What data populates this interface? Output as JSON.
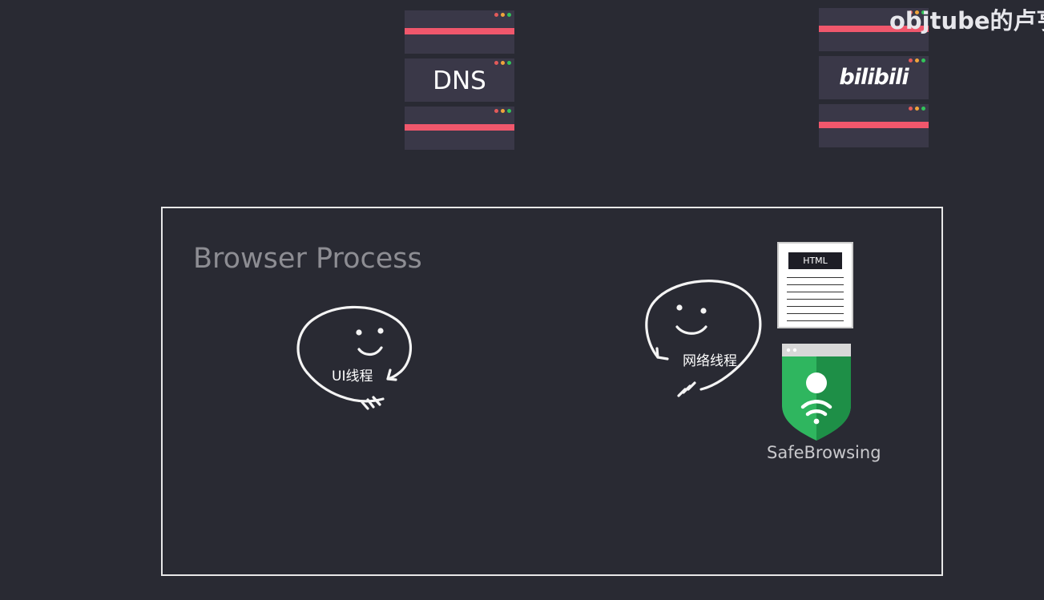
{
  "watermark": "objtube的卢亨",
  "servers": {
    "dns_label": "DNS",
    "bilibili_label": "bilibili"
  },
  "diagram": {
    "title": "Browser Process",
    "ui_thread_label": "UI线程",
    "network_thread_label": "网络线程",
    "html_tag": "HTML",
    "safebrowsing_label": "SafeBrowsing"
  },
  "colors": {
    "background": "#292a33",
    "server_body": "#3a3848",
    "server_stripe": "#f0576c",
    "shield_light": "#2fb65f",
    "shield_dark": "#1e8f47"
  },
  "icons": [
    "server-icon",
    "bilibili-logo",
    "smiley-thread-icon",
    "html-document-icon",
    "safebrowsing-shield-icon"
  ]
}
